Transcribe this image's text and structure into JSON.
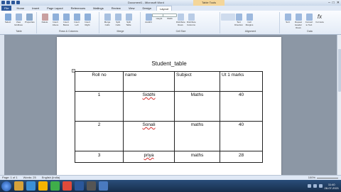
{
  "window": {
    "title": "Document1 - Microsoft Word",
    "context_tab": "Table Tools",
    "controls": [
      "–",
      "□",
      "✕"
    ]
  },
  "tabs": [
    "File",
    "Home",
    "Insert",
    "Page Layout",
    "References",
    "Mailings",
    "Review",
    "View",
    "Design",
    "Layout"
  ],
  "ribbon": {
    "groups": [
      {
        "label": "Table",
        "buttons": [
          "Select",
          "View Gridlines",
          "Properties"
        ]
      },
      {
        "label": "Rows & Columns",
        "buttons": [
          "Delete",
          "Insert Above",
          "Insert Below",
          "Insert Left",
          "Insert Right"
        ]
      },
      {
        "label": "Merge",
        "buttons": [
          "Merge Cells",
          "Split Cells",
          "Split Table"
        ]
      },
      {
        "label": "Cell Size",
        "buttons": [
          "AutoFit",
          "Height",
          "Width",
          "Distribute Rows",
          "Distribute Columns"
        ]
      },
      {
        "label": "Alignment",
        "buttons": [
          "Text Direction",
          "Cell Margins"
        ]
      },
      {
        "label": "Data",
        "buttons": [
          "Sort",
          "Repeat Header Rows",
          "Convert to Text",
          "Formula"
        ]
      }
    ]
  },
  "document": {
    "table_title": "Student_table",
    "headers": [
      "Roll no",
      "name",
      "Subject",
      "Ut 1 marks"
    ],
    "rows": [
      [
        "1",
        "Siddhi",
        "Maths",
        "40"
      ],
      [
        "2",
        "Sonali",
        "maths",
        "40"
      ],
      [
        "3",
        "priya",
        "maths",
        "28"
      ]
    ]
  },
  "statusbar": {
    "page": "Page: 1 of 1",
    "words": "Words: 25",
    "language": "English (India)",
    "zoom": "100%"
  },
  "taskbar": {
    "time": "11:40",
    "date": "28-07-2021"
  },
  "colors": {
    "file_tab": "#2b579a",
    "context_tab": "#f4d69a",
    "taskbar": "#1f3a60"
  }
}
